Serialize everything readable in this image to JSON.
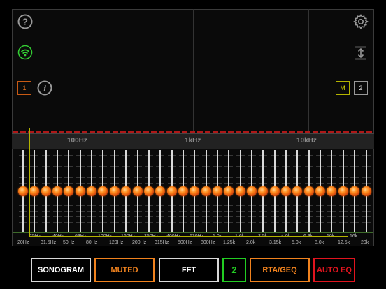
{
  "top_left": {
    "help_icon": "help-circle-icon",
    "wifi_icon": "wifi-icon",
    "channel_button": "1",
    "info_icon": "info-icon"
  },
  "top_right": {
    "settings_icon": "gear-icon",
    "expand_icon": "vertical-expand-icon",
    "m_button": "M",
    "two_button": "2"
  },
  "freq_axis": [
    "100Hz",
    "1kHz",
    "10kHz"
  ],
  "eq_bands_top": [
    "25Hz",
    "40Hz",
    "63Hz",
    "100Hz",
    "160Hz",
    "250Hz",
    "400Hz",
    "630Hz",
    "1.0k",
    "1.6k",
    "2.5k",
    "4.0k",
    "6.3k",
    "10k",
    "16k"
  ],
  "eq_bands_bottom": [
    "20Hz",
    "31.5Hz",
    "50Hz",
    "80Hz",
    "120Hz",
    "200Hz",
    "315Hz",
    "500Hz",
    "800Hz",
    "1.25k",
    "2.0k",
    "3.15k",
    "5.0k",
    "8.0k",
    "12.5k",
    "20k"
  ],
  "slider_level": 0.5,
  "bottom_bar": {
    "sonogram": "SONOGRAM",
    "muted": "MUTED",
    "fft": "FFT",
    "count": "2",
    "rta_geq": "RTA/GEQ",
    "auto_eq": "AUTO EQ"
  },
  "colors": {
    "accent_orange": "#f0821e",
    "auto_eq_red": "#e0141e",
    "count_green": "#22cc22",
    "wifi_green": "#33cc33",
    "select_yellow": "#b4b400"
  }
}
